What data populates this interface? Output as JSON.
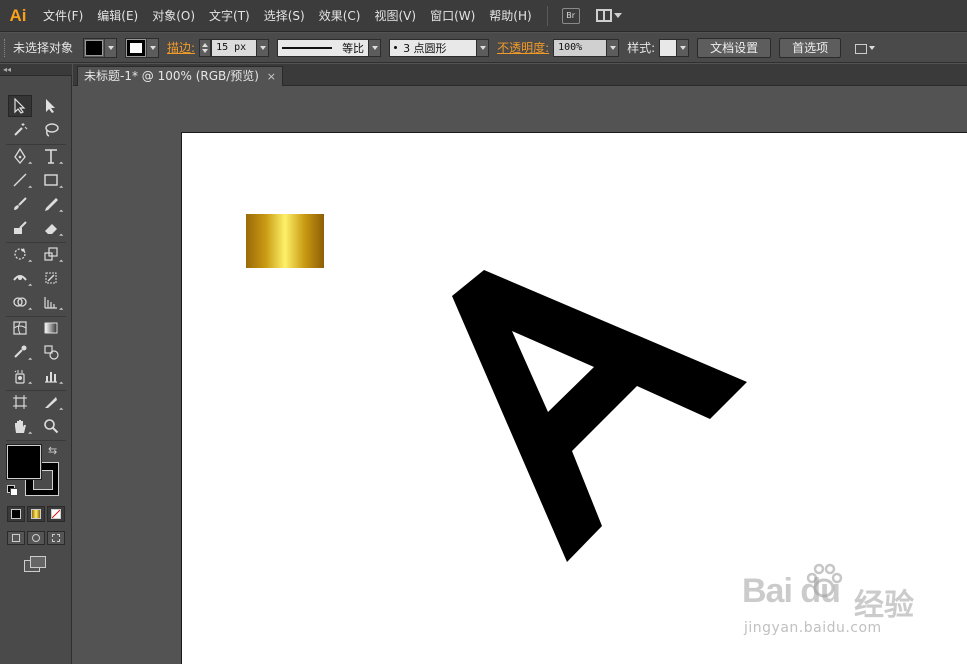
{
  "app": {
    "logo": "Ai"
  },
  "menu": {
    "items": [
      "文件(F)",
      "编辑(E)",
      "对象(O)",
      "文字(T)",
      "选择(S)",
      "效果(C)",
      "视图(V)",
      "窗口(W)",
      "帮助(H)"
    ],
    "bridge_label": "Br"
  },
  "control_bar": {
    "selection_status": "未选择对象",
    "stroke_link": "描边:",
    "stroke_weight": "15 px",
    "stroke_profile_label": "等比",
    "brush_label": "3 点圆形",
    "opacity_link": "不透明度:",
    "opacity_value": "100%",
    "style_label": "样式:",
    "document_setup_button": "文档设置",
    "preferences_button": "首选项"
  },
  "tools_panel": {
    "collapse_glyph": "◂◂"
  },
  "document": {
    "tab_title": "未标题-1* @ 100% (RGB/预览)",
    "close_glyph": "×"
  },
  "artwork": {
    "gradient_colors": [
      "#9a6a08",
      "#c99a12",
      "#fdf06a",
      "#c99a12",
      "#8d5e06"
    ],
    "letter_color": "#000000"
  },
  "watermark": {
    "logo": "Bai du",
    "brand_cn": "经验",
    "url": "jingyan.baidu.com"
  },
  "colors": {
    "accent_orange": "#f19a2a",
    "logo_orange": "#f7a11a",
    "chrome_dark": "#3c3c3c",
    "panel": "#4a4a4a",
    "canvas_bg": "#535353"
  }
}
